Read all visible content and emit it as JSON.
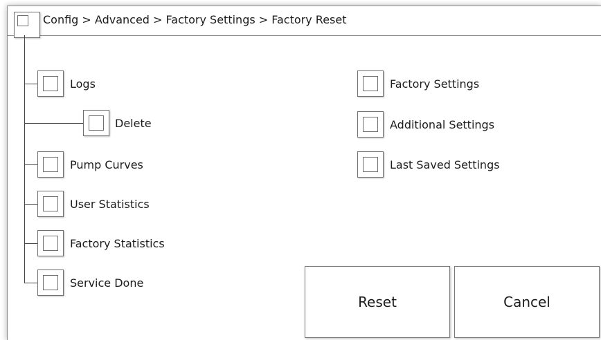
{
  "header": {
    "breadcrumb": "Config > Advanced > Factory Settings > Factory Reset"
  },
  "left_options": [
    {
      "label": "Logs"
    },
    {
      "label": "Delete"
    },
    {
      "label": "Pump Curves"
    },
    {
      "label": "User Statistics"
    },
    {
      "label": "Factory Statistics"
    },
    {
      "label": "Service Done"
    }
  ],
  "right_options": [
    {
      "label": "Factory Settings"
    },
    {
      "label": "Additional Settings"
    },
    {
      "label": "Last Saved Settings"
    }
  ],
  "buttons": {
    "reset_label": "Reset",
    "cancel_label": "Cancel"
  },
  "icons": {
    "checkbox": "checkbox-unchecked-icon"
  }
}
